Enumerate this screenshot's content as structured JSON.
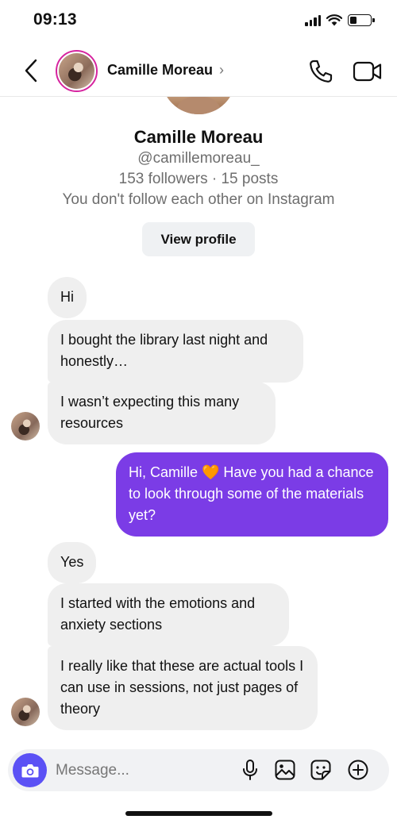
{
  "status_bar": {
    "time": "09:13",
    "icons": [
      "cellular-signal-icon",
      "wifi-icon",
      "battery-icon"
    ],
    "battery_level": 0.35
  },
  "header": {
    "contact_name": "Camille Moreau",
    "chevron": "›",
    "icons": [
      "back-chevron-icon",
      "phone-icon",
      "video-camera-icon"
    ]
  },
  "profile": {
    "name": "Camille Moreau",
    "handle": "@camillemoreau_",
    "stats": "153 followers · 15 posts",
    "follow_note": "You don't follow each other on Instagram",
    "view_profile_label": "View profile"
  },
  "messages": [
    {
      "sender": "them",
      "text": "Hi"
    },
    {
      "sender": "them",
      "text": "I bought the library last night and honestly…"
    },
    {
      "sender": "them",
      "text": "I wasn’t expecting this many resources"
    },
    {
      "sender": "me",
      "text": "Hi, Camille 🧡 Have you had a chance to look through some of the materials yet?"
    },
    {
      "sender": "them",
      "text": "Yes"
    },
    {
      "sender": "them",
      "text": "I started with the emotions and anxiety sections"
    },
    {
      "sender": "them",
      "text": "I really like that these are actual tools I can use in sessions, not just pages of theory"
    }
  ],
  "composer": {
    "placeholder": "Message...",
    "icons": [
      "camera-icon",
      "microphone-icon",
      "gallery-icon",
      "sticker-icon",
      "plus-circle-icon"
    ]
  },
  "colors": {
    "outgoing_bubble": "#7b3ce6",
    "incoming_bubble": "#efefef",
    "camera_button": "#5b51f5",
    "avatar_ring": "#d6249f"
  }
}
